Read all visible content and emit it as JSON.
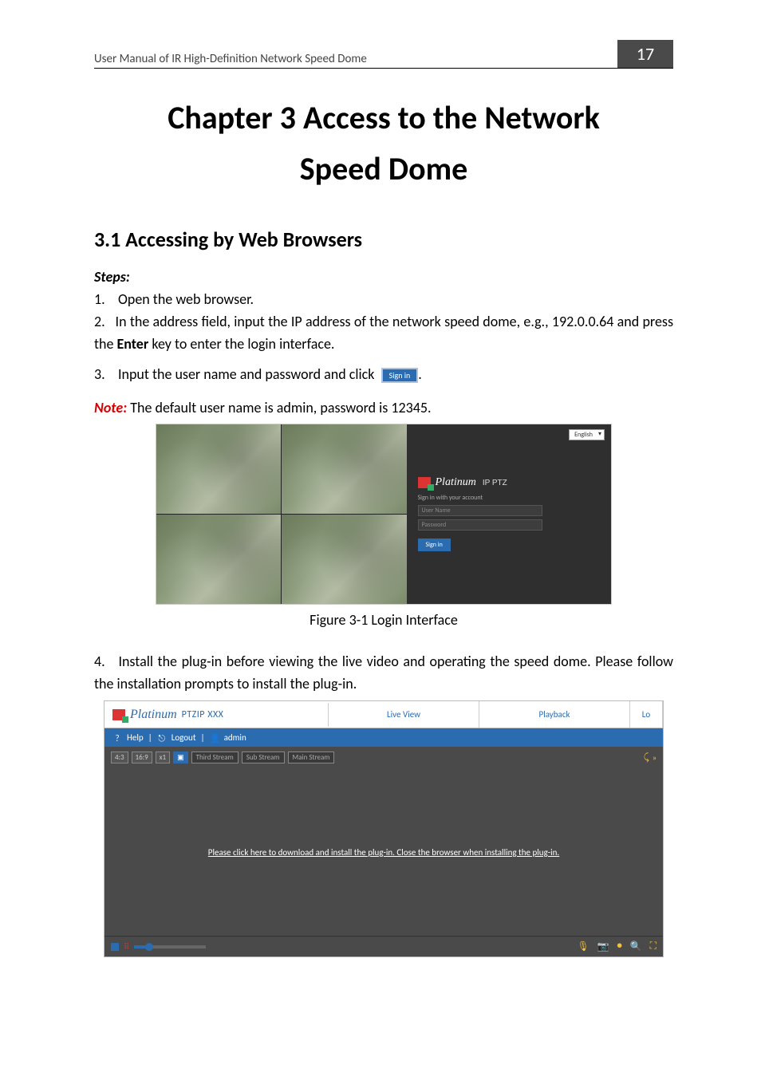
{
  "header": {
    "running_title": "User Manual of IR High-Definition Network Speed Dome",
    "page_number": "17"
  },
  "chapter": {
    "title_line1": "Chapter 3  Access to the Network",
    "title_line2": "Speed Dome"
  },
  "section": {
    "number_title": "3.1  Accessing by Web Browsers"
  },
  "steps_label": "Steps:",
  "steps": {
    "s1_num": "1.",
    "s1_text": "Open the web browser.",
    "s2_num": "2.",
    "s2_text_a": "In the address field, input the IP address of the network speed dome, e.g., 192.0.0.64 and press the ",
    "s2_enter": "Enter",
    "s2_text_b": " key to enter the login interface.",
    "s3_num": "3.",
    "s3_text": "Input the user name and password and click",
    "s3_btn": "Sign in",
    "s3_period": "."
  },
  "note": {
    "label": "Note:",
    "text": " The default user name is admin, password is 12345."
  },
  "fig1": {
    "lang": "English",
    "brand": "Platinum",
    "brand_suffix": "IP PTZ",
    "signin_prompt": "Sign in with your account",
    "user_placeholder": "User Name",
    "pass_placeholder": "Password",
    "signin_btn": "Sign in",
    "caption": "Figure 3-1 Login Interface"
  },
  "step4": {
    "num": "4.",
    "text": "Install the plug-in before viewing the live video and operating the speed dome. Please follow the installation prompts to install the plug-in."
  },
  "fig2": {
    "brand": "Platinum",
    "model": "PTZIP XXX",
    "tab_live": "Live View",
    "tab_playback": "Playback",
    "tab_lo": "Lo",
    "help": "Help",
    "logout": "Logout",
    "user": "admin",
    "aspect_43": "4:3",
    "aspect_169": "16:9",
    "aspect_x1": "x1",
    "stream_third": "Third Stream",
    "stream_sub": "Sub Stream",
    "stream_main": "Main Stream",
    "viewport_msg": "Please click here to download and install the plug-in. Close the browser when installing the plug-in."
  }
}
